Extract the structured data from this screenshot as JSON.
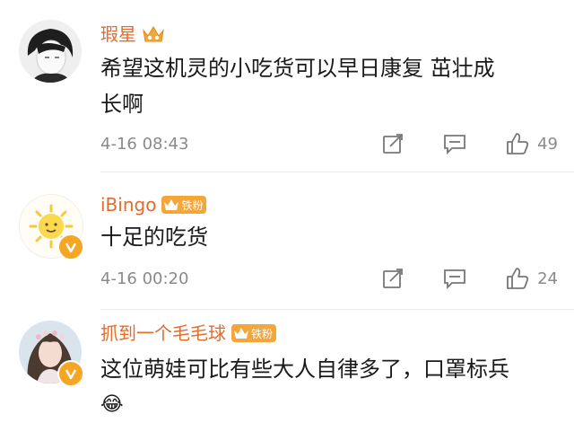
{
  "comments": [
    {
      "username": "瑕星",
      "content_line1": "希望这机灵的小吃货可以早日康复 茁壮成",
      "content_line2": "长啊",
      "time": "4-16 08:43",
      "likes": "49"
    },
    {
      "username": "iBingo",
      "fan_badge": "铁粉",
      "content_line1": "十足的吃货",
      "time": "4-16 00:20",
      "likes": "24"
    },
    {
      "username": "抓到一个毛毛球",
      "fan_badge": "铁粉",
      "content_line1": "这位萌娃可比有些大人自律多了，口罩标兵",
      "emoji": "😂"
    }
  ],
  "colors": {
    "username": "#e36b2c",
    "crown": "#f4a63a",
    "meta": "#8a8a8a",
    "verify_badge": "#f5a623"
  },
  "icons": [
    "repost-icon",
    "comment-icon",
    "like-icon",
    "crown-icon",
    "verified-v-icon"
  ]
}
